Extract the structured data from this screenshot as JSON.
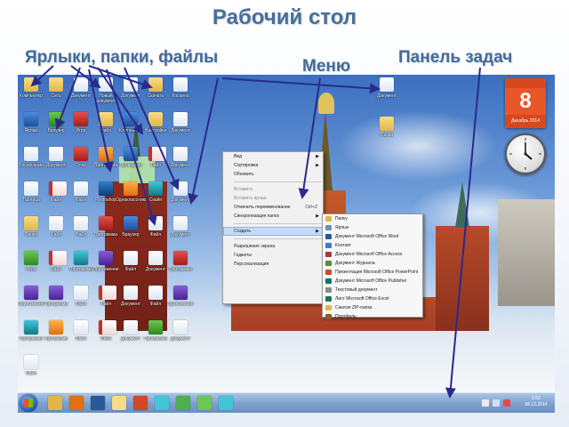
{
  "slide": {
    "title": "Рабочий стол",
    "labels": {
      "shortcuts": "Ярлыки, папки, файлы",
      "menu": "Меню",
      "taskbar": "Панель задач"
    }
  },
  "colors": {
    "title": "#4a6e98",
    "arrow": "#2a2a8c",
    "taskbar": "#7fa3d0"
  },
  "desktop": {
    "icons": [
      {
        "label": "Компьютер",
        "icon": "folder-icon"
      },
      {
        "label": "Сеть",
        "icon": "folder-icon"
      },
      {
        "label": "Документ",
        "icon": "doc-icon"
      },
      {
        "label": "Новый документ",
        "icon": "doc-icon"
      },
      {
        "label": "Документ",
        "icon": "doc-icon"
      },
      {
        "label": "Скачать",
        "icon": "folder-icon"
      },
      {
        "label": "Корзина",
        "icon": "doc-icon"
      },
      {
        "label": "Ярлык",
        "icon": "blue-app-icon"
      },
      {
        "label": "Браузер",
        "icon": "green-app-icon"
      },
      {
        "label": "Игра",
        "icon": "red-app-icon"
      },
      {
        "label": "Файл",
        "icon": "folder-icon"
      },
      {
        "label": "Компьютер",
        "icon": "blue-app-icon"
      },
      {
        "label": "Настройки",
        "icon": "folder-icon"
      },
      {
        "label": "Документ",
        "icon": "doc-icon"
      },
      {
        "label": "Расписание",
        "icon": "doc-icon"
      },
      {
        "label": "Документ",
        "icon": "doc-icon"
      },
      {
        "label": "Отчёт",
        "icon": "red-app-icon"
      },
      {
        "label": "Программа",
        "icon": "orange-app-icon"
      },
      {
        "label": "Проводник",
        "icon": "blue-app-icon"
      },
      {
        "label": "Файл",
        "icon": "pdf-icon"
      },
      {
        "label": "Документ",
        "icon": "doc-icon"
      },
      {
        "label": "Таблица",
        "icon": "doc-icon"
      },
      {
        "label": "Файл",
        "icon": "pdf-icon"
      },
      {
        "label": "Файл",
        "icon": "doc-icon"
      },
      {
        "label": "Photoshop",
        "icon": "ps-app-icon"
      },
      {
        "label": "Одноклассники",
        "icon": "orange-app-icon"
      },
      {
        "label": "Скайп",
        "icon": "teal-app-icon"
      },
      {
        "label": "Документ",
        "icon": "doc-icon"
      },
      {
        "label": "Папка",
        "icon": "folder-icon"
      },
      {
        "label": "Файл",
        "icon": "doc-icon"
      },
      {
        "label": "Файл",
        "icon": "doc-icon"
      },
      {
        "label": "Программа",
        "icon": "red-app-icon"
      },
      {
        "label": "Браузер",
        "icon": "blue-app-icon"
      },
      {
        "label": "Файл",
        "icon": "doc-icon"
      },
      {
        "label": "Документ",
        "icon": "doc-icon"
      },
      {
        "label": "Игра",
        "icon": "green-app-icon"
      },
      {
        "label": "Файл",
        "icon": "pdf-icon"
      },
      {
        "label": "Программа",
        "icon": "teal-app-icon"
      },
      {
        "label": "Приложение",
        "icon": "purple-app-icon"
      },
      {
        "label": "Файл",
        "icon": "doc-icon"
      },
      {
        "label": "Документ",
        "icon": "doc-icon"
      },
      {
        "label": "Программа",
        "icon": "red-app-icon"
      },
      {
        "label": "Приложение",
        "icon": "purple-app-icon"
      },
      {
        "label": "Программа",
        "icon": "purple-app-icon"
      },
      {
        "label": "Файл",
        "icon": "doc-icon"
      },
      {
        "label": "Файл",
        "icon": "pdf-icon"
      },
      {
        "label": "Документ",
        "icon": "doc-icon"
      },
      {
        "label": "Файл",
        "icon": "doc-icon"
      },
      {
        "label": "Приложение",
        "icon": "purple-app-icon"
      },
      {
        "label": "Программа",
        "icon": "teal-app-icon"
      },
      {
        "label": "Программа",
        "icon": "orange-app-icon"
      },
      {
        "label": "Файл",
        "icon": "doc-icon"
      },
      {
        "label": "Файл",
        "icon": "pdf-icon"
      },
      {
        "label": "Документ",
        "icon": "doc-icon"
      },
      {
        "label": "Программа",
        "icon": "green-app-icon"
      },
      {
        "label": "Документ",
        "icon": "doc-icon"
      },
      {
        "label": "Файл",
        "icon": "doc-icon"
      }
    ],
    "right_icons": [
      {
        "label": "Документ",
        "icon": "doc-icon"
      },
      {
        "label": "Папка",
        "icon": "folder-icon"
      }
    ]
  },
  "gadgets": {
    "calendar_day": "8",
    "calendar_month": "Декабрь 2014"
  },
  "context_menu": {
    "items": [
      {
        "label": "Вид",
        "arrow": "▶",
        "type": "normal"
      },
      {
        "label": "Сортировка",
        "arrow": "▶",
        "type": "normal"
      },
      {
        "label": "Обновить",
        "arrow": "",
        "type": "normal"
      },
      {
        "type": "sep"
      },
      {
        "label": "Вставить",
        "arrow": "",
        "type": "dis"
      },
      {
        "label": "Вставить ярлык",
        "arrow": "",
        "type": "dis"
      },
      {
        "label": "Отменить переименование",
        "key": "Ctrl+Z",
        "type": "normal"
      },
      {
        "label": "Синхронизация папок",
        "arrow": "▶",
        "type": "normal"
      },
      {
        "type": "sep"
      },
      {
        "label": "Создать",
        "arrow": "▶",
        "type": "sel"
      },
      {
        "type": "sep"
      },
      {
        "label": "Разрешение экрана",
        "arrow": "",
        "type": "normal"
      },
      {
        "label": "Гаджеты",
        "arrow": "",
        "type": "normal"
      },
      {
        "label": "Персонализация",
        "arrow": "",
        "type": "normal"
      }
    ]
  },
  "submenu": {
    "items": [
      {
        "label": "Папку",
        "color": "#e2b64a"
      },
      {
        "label": "Ярлык",
        "color": "#6a8fc0"
      },
      {
        "label": "Документ Microsoft Office Word",
        "color": "#2b5797"
      },
      {
        "label": "Контакт",
        "color": "#3a7bd5"
      },
      {
        "label": "Документ Microsoft Office Access",
        "color": "#a4373a"
      },
      {
        "label": "Документ Журнала",
        "color": "#5a8a3a"
      },
      {
        "label": "Презентация Microsoft Office PowerPoint",
        "color": "#d24726"
      },
      {
        "label": "Документ Microsoft Office Publisher",
        "color": "#077568"
      },
      {
        "label": "Текстовый документ",
        "color": "#8a8a8a"
      },
      {
        "label": "Лист Microsoft Office Excel",
        "color": "#217346"
      },
      {
        "label": "Сжатая ZIP-папка",
        "color": "#e2b64a"
      },
      {
        "label": "Портфель",
        "color": "#8a5a2a"
      }
    ]
  },
  "taskbar": {
    "buttons": [
      {
        "name": "explorer-button",
        "icon": "folder-icon",
        "color": "#e2b64a"
      },
      {
        "name": "media-player-button",
        "icon": "media-icon",
        "color": "#e07010"
      },
      {
        "name": "word-button",
        "icon": "word-icon",
        "color": "#2b5797"
      },
      {
        "name": "folder-button",
        "icon": "folder-icon",
        "color": "#f7dc86"
      },
      {
        "name": "powerpoint-button",
        "icon": "ppt-icon",
        "color": "#d24726"
      },
      {
        "name": "paint-button",
        "icon": "paint-icon",
        "color": "#3fc6d8"
      },
      {
        "name": "chrome-button",
        "icon": "chrome-icon",
        "color": "#4caf50"
      },
      {
        "name": "program-button",
        "icon": "app-icon",
        "color": "#6cc850"
      },
      {
        "name": "skype-button",
        "icon": "skype-icon",
        "color": "#3fc6d8"
      }
    ],
    "tray_time": "1:52",
    "tray_date": "08.12.2014"
  }
}
